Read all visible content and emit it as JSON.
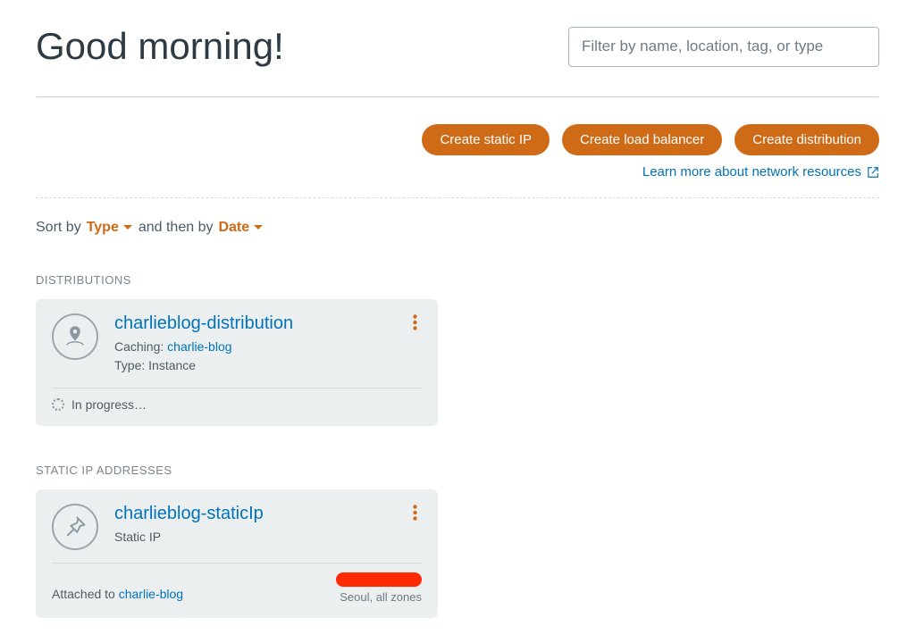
{
  "header": {
    "greeting": "Good morning!",
    "filter_placeholder": "Filter by name, location, tag, or type"
  },
  "actions": {
    "create_static_ip": "Create static IP",
    "create_load_balancer": "Create load balancer",
    "create_distribution": "Create distribution",
    "learn_more": "Learn more about network resources"
  },
  "sort": {
    "sort_by_label": "Sort by",
    "primary": "Type",
    "and_then_by": "and then by",
    "secondary": "Date"
  },
  "sections": {
    "distributions": {
      "heading": "DISTRIBUTIONS",
      "card": {
        "title": "charlieblog-distribution",
        "caching_label": "Caching:",
        "caching_target": "charlie-blog",
        "type_label": "Type:",
        "type_value": "Instance",
        "status": "In progress…"
      }
    },
    "static_ips": {
      "heading": "STATIC IP ADDRESSES",
      "card": {
        "title": "charlieblog-staticIp",
        "subtitle": "Static IP",
        "attached_label": "Attached to",
        "attached_target": "charlie-blog",
        "region": "Seoul, all zones"
      }
    }
  }
}
